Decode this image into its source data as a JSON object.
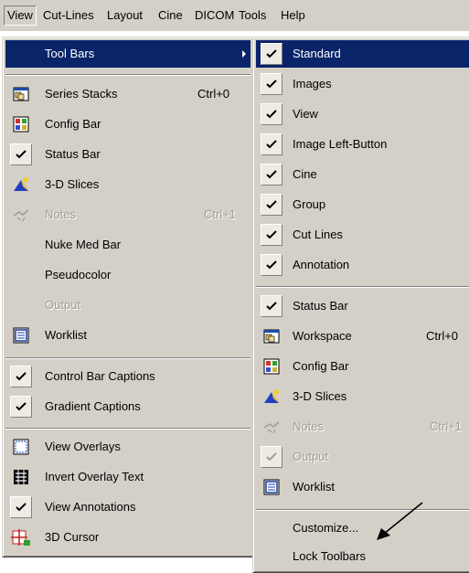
{
  "menubar": {
    "items": [
      {
        "label": "View"
      },
      {
        "label": "Cut-Lines"
      },
      {
        "label": "Layout"
      },
      {
        "label": "Cine"
      },
      {
        "label": "DICOM"
      },
      {
        "label": "Tools"
      },
      {
        "label": "Help"
      }
    ]
  },
  "view_menu": {
    "tool_bars": "Tool Bars",
    "series_stacks": "Series Stacks",
    "series_stacks_shortcut": "Ctrl+0",
    "config_bar": "Config Bar",
    "status_bar": "Status Bar",
    "slices_3d": "3-D Slices",
    "notes": "Notes",
    "notes_shortcut": "Ctrl+1",
    "nuke_med_bar": "Nuke Med Bar",
    "pseudocolor": "Pseudocolor",
    "output": "Output",
    "worklist": "Worklist",
    "control_bar_captions": "Control Bar Captions",
    "gradient_captions": "Gradient Captions",
    "view_overlays": "View Overlays",
    "invert_overlay_text": "Invert Overlay Text",
    "view_annotations": "View Annotations",
    "cursor_3d": "3D Cursor"
  },
  "toolbars_menu": {
    "standard": "Standard",
    "images": "Images",
    "view": "View",
    "image_left_button": "Image Left-Button",
    "cine": "Cine",
    "group": "Group",
    "cut_lines": "Cut Lines",
    "annotation": "Annotation",
    "status_bar": "Status Bar",
    "workspace": "Workspace",
    "workspace_shortcut": "Ctrl+0",
    "config_bar": "Config Bar",
    "slices_3d": "3-D Slices",
    "notes": "Notes",
    "notes_shortcut": "Ctrl+1",
    "output": "Output",
    "worklist": "Worklist",
    "customize": "Customize...",
    "lock_toolbars": "Lock Toolbars"
  },
  "colors": {
    "face": "#d4d0c8",
    "highlight": "#0a246a",
    "disabled": "#a09c94"
  }
}
